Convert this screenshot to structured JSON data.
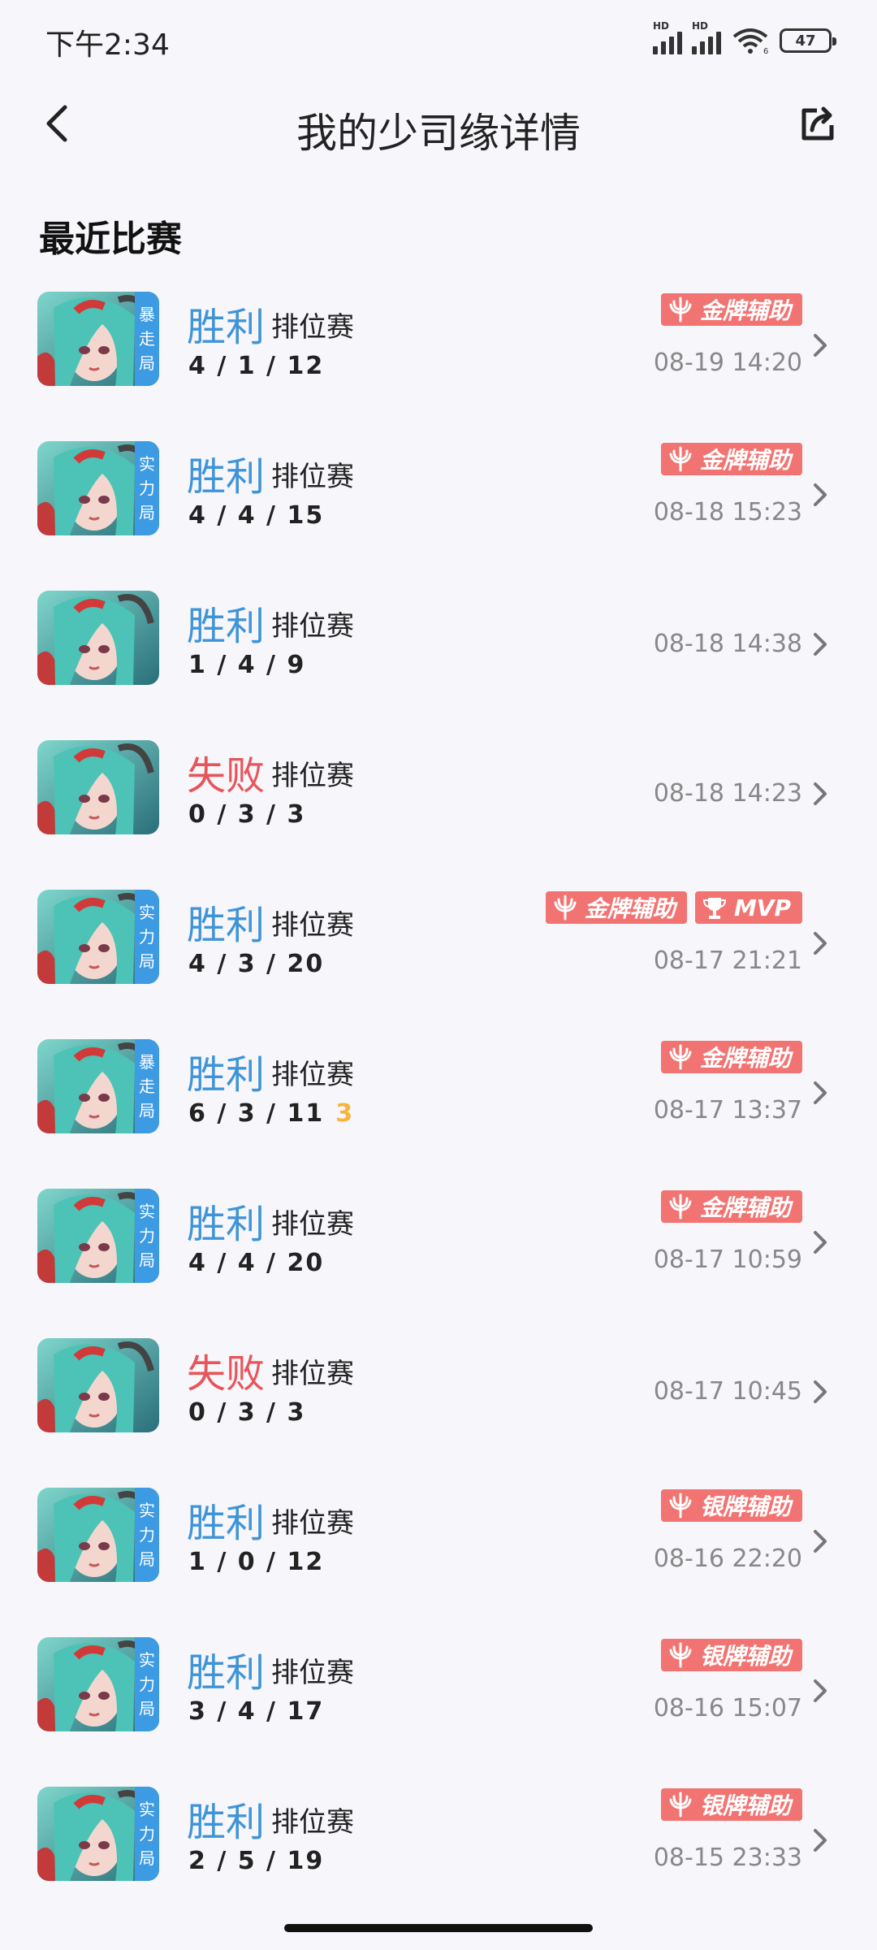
{
  "status_bar": {
    "time": "下午2:34",
    "battery": "47",
    "hd1": "HD",
    "hd2": "HD",
    "wifi_sub": "6"
  },
  "header": {
    "title": "我的少司缘详情"
  },
  "section": {
    "title": "最近比赛"
  },
  "colors": {
    "win": "#3f94d8",
    "lose": "#e7555a",
    "badge": "#f27472",
    "mode_tag": "#3d9be3"
  },
  "matches": [
    {
      "result": "胜利",
      "outcome": "win",
      "type": "排位赛",
      "kda": "4 / 1 / 12",
      "mode": "暴走局",
      "badges": [
        "金牌辅助"
      ],
      "date": "08-19 14:20"
    },
    {
      "result": "胜利",
      "outcome": "win",
      "type": "排位赛",
      "kda": "4 / 4 / 15",
      "mode": "实力局",
      "badges": [
        "金牌辅助"
      ],
      "date": "08-18 15:23"
    },
    {
      "result": "胜利",
      "outcome": "win",
      "type": "排位赛",
      "kda": "1 / 4 / 9",
      "mode": "",
      "badges": [],
      "date": "08-18 14:38"
    },
    {
      "result": "失败",
      "outcome": "lose",
      "type": "排位赛",
      "kda": "0 / 3 / 3",
      "mode": "",
      "badges": [],
      "date": "08-18 14:23"
    },
    {
      "result": "胜利",
      "outcome": "win",
      "type": "排位赛",
      "kda": "4 / 3 / 20",
      "mode": "实力局",
      "badges": [
        "金牌辅助",
        "MVP"
      ],
      "date": "08-17 21:21"
    },
    {
      "result": "胜利",
      "outcome": "win",
      "type": "排位赛",
      "kda": "6 / 3 / 11",
      "streak": "3",
      "mode": "暴走局",
      "badges": [
        "金牌辅助"
      ],
      "date": "08-17 13:37"
    },
    {
      "result": "胜利",
      "outcome": "win",
      "type": "排位赛",
      "kda": "4 / 4 / 20",
      "mode": "实力局",
      "badges": [
        "金牌辅助"
      ],
      "date": "08-17 10:59"
    },
    {
      "result": "失败",
      "outcome": "lose",
      "type": "排位赛",
      "kda": "0 / 3 / 3",
      "mode": "",
      "badges": [],
      "date": "08-17 10:45"
    },
    {
      "result": "胜利",
      "outcome": "win",
      "type": "排位赛",
      "kda": "1 / 0 / 12",
      "mode": "实力局",
      "badges": [
        "银牌辅助"
      ],
      "date": "08-16 22:20"
    },
    {
      "result": "胜利",
      "outcome": "win",
      "type": "排位赛",
      "kda": "3 / 4 / 17",
      "mode": "实力局",
      "badges": [
        "银牌辅助"
      ],
      "date": "08-16 15:07"
    },
    {
      "result": "胜利",
      "outcome": "win",
      "type": "排位赛",
      "kda": "2 / 5 / 19",
      "mode": "实力局",
      "badges": [
        "银牌辅助"
      ],
      "date": "08-15 23:33"
    }
  ]
}
